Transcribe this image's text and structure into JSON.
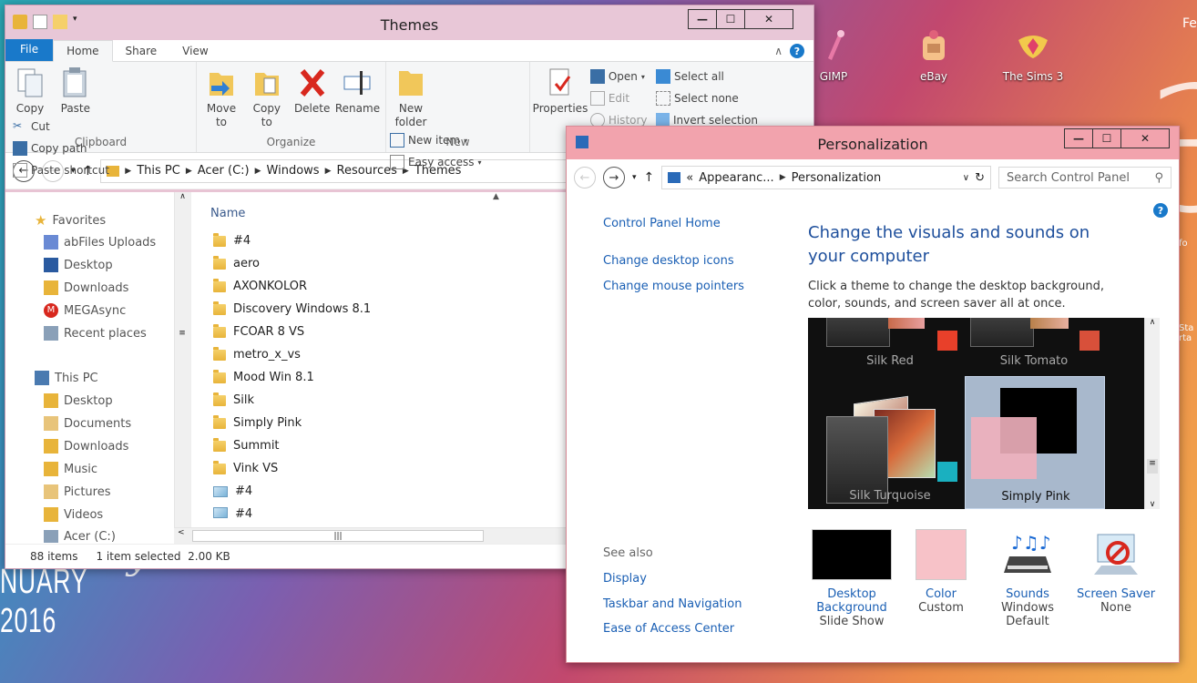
{
  "desktop": {
    "date_script": "Friday",
    "date_month": "NUARY 2016",
    "big_digit": "3",
    "corner_text": "Fe",
    "icons": [
      {
        "name": "gimp-icon",
        "label": "GIMP"
      },
      {
        "name": "ebay-icon",
        "label": "eBay"
      },
      {
        "name": "sims-icon",
        "label": "The Sims 3"
      }
    ],
    "edge_labels": [
      "fo",
      "Sta",
      "rta"
    ]
  },
  "explorer": {
    "title": "Themes",
    "controls": {
      "min": "—",
      "max": "☐",
      "close": "✕"
    },
    "tabs": [
      "File",
      "Home",
      "Share",
      "View"
    ],
    "clipboard": {
      "copy": "Copy",
      "paste": "Paste",
      "cut": "Cut",
      "copy_path": "Copy path",
      "paste_shortcut": "Paste shortcut",
      "label": "Clipboard"
    },
    "organize": {
      "move_to": "Move to",
      "copy_to": "Copy to",
      "delete": "Delete",
      "rename": "Rename",
      "label": "Organize"
    },
    "new": {
      "new_folder": "New folder",
      "new_item": "New item",
      "easy_access": "Easy access",
      "label": "New"
    },
    "open": {
      "properties": "Properties",
      "open": "Open",
      "edit": "Edit",
      "history": "History"
    },
    "select": {
      "select_all": "Select all",
      "select_none": "Select none",
      "invert": "Invert selection"
    },
    "breadcrumb": [
      "This PC",
      "Acer (C:)",
      "Windows",
      "Resources",
      "Themes"
    ],
    "nav": [
      {
        "label": "Favorites",
        "icon": "star-icon"
      },
      {
        "label": "abFiles Uploads",
        "icon": "folder-icon"
      },
      {
        "label": "Desktop",
        "icon": "desktop-icon"
      },
      {
        "label": "Downloads",
        "icon": "downloads-icon"
      },
      {
        "label": "MEGAsync",
        "icon": "mega-icon"
      },
      {
        "label": "Recent places",
        "icon": "recent-icon"
      },
      {
        "label": "This PC",
        "icon": "pc-icon"
      },
      {
        "label": "Desktop",
        "icon": "desktop-icon"
      },
      {
        "label": "Documents",
        "icon": "documents-icon"
      },
      {
        "label": "Downloads",
        "icon": "downloads-icon"
      },
      {
        "label": "Music",
        "icon": "music-icon"
      },
      {
        "label": "Pictures",
        "icon": "pictures-icon"
      },
      {
        "label": "Videos",
        "icon": "videos-icon"
      },
      {
        "label": "Acer (C:)",
        "icon": "drive-icon"
      }
    ],
    "column_header": "Name",
    "files": [
      {
        "name": "#4",
        "type": "folder"
      },
      {
        "name": "aero",
        "type": "folder"
      },
      {
        "name": "AXONKOLOR",
        "type": "folder"
      },
      {
        "name": "Discovery Windows 8.1",
        "type": "folder"
      },
      {
        "name": "FCOAR 8 VS",
        "type": "folder"
      },
      {
        "name": "metro_x_vs",
        "type": "folder"
      },
      {
        "name": "Mood Win 8.1",
        "type": "folder"
      },
      {
        "name": "Silk",
        "type": "folder"
      },
      {
        "name": "Simply Pink",
        "type": "folder"
      },
      {
        "name": "Summit",
        "type": "folder"
      },
      {
        "name": "Vink VS",
        "type": "folder"
      },
      {
        "name": "#4",
        "type": "theme"
      },
      {
        "name": "#4",
        "type": "theme"
      }
    ],
    "status": {
      "count": "88 items",
      "selected": "1 item selected",
      "size": "2.00 KB"
    }
  },
  "personalization": {
    "title": "Personalization",
    "controls": {
      "min": "—",
      "max": "☐",
      "close": "✕"
    },
    "breadcrumb": {
      "prefix": "«",
      "parent": "Appearanc...",
      "current": "Personalization"
    },
    "search_placeholder": "Search Control Panel",
    "left_links": [
      "Control Panel Home",
      "Change desktop icons",
      "Change mouse pointers"
    ],
    "see_also_title": "See also",
    "see_also": [
      "Display",
      "Taskbar and Navigation",
      "Ease of Access Center"
    ],
    "heading": "Change the visuals and sounds on your computer",
    "description": "Click a theme to change the desktop background, color, sounds, and screen saver all at once.",
    "themes": [
      {
        "name": "Silk Red",
        "color": "#e8402a"
      },
      {
        "name": "Silk Tomato",
        "color": "#d8503a"
      },
      {
        "name": "Silk Turquoise",
        "color": "#1ab0c0"
      },
      {
        "name": "Simply Pink",
        "color": "#f0b0bc"
      }
    ],
    "bottom": [
      {
        "label": "Desktop Background",
        "sub": "Slide Show",
        "icon": "desktop-background-icon"
      },
      {
        "label": "Color",
        "sub": "Custom",
        "icon": "color-swatch-icon"
      },
      {
        "label": "Sounds",
        "sub": "Windows Default",
        "icon": "sounds-icon"
      },
      {
        "label": "Screen Saver",
        "sub": "None",
        "icon": "screen-saver-icon"
      }
    ],
    "help": "?"
  }
}
